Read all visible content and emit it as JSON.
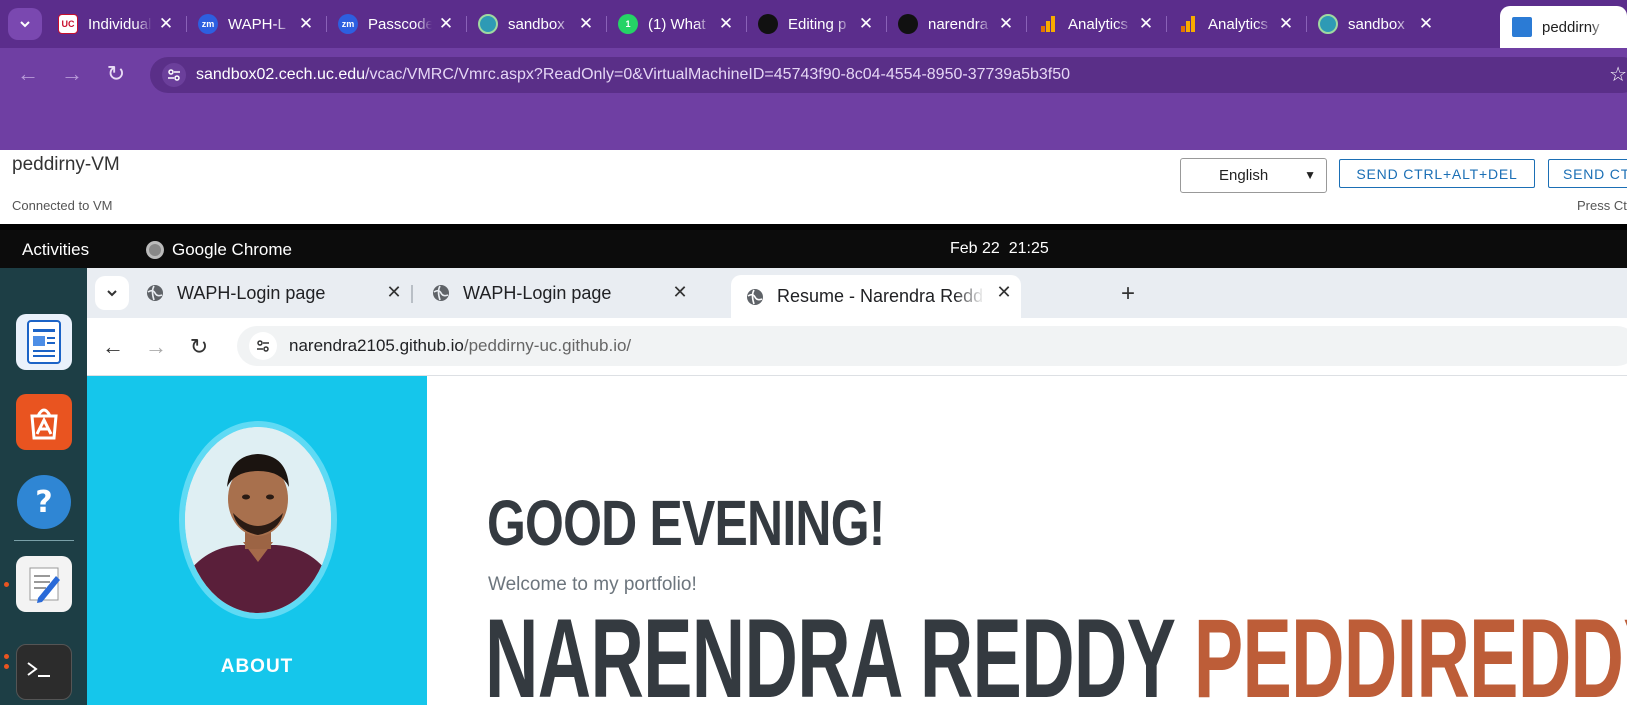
{
  "outer_browser": {
    "tabs": [
      {
        "title": "Individual",
        "favicon": "uc-logo-icon",
        "color": "#c8102e"
      },
      {
        "title": "WAPH-L",
        "favicon": "zoom-icon",
        "color": "#2d5fe0"
      },
      {
        "title": "Passcode",
        "favicon": "zoom-icon",
        "color": "#2d5fe0"
      },
      {
        "title": "sandbox",
        "favicon": "globe-icon",
        "color": "#2e9ab5"
      },
      {
        "title": "(1) What",
        "favicon": "whatsapp-icon",
        "color": "#25d366"
      },
      {
        "title": "Editing p",
        "favicon": "github-icon",
        "color": "#000000"
      },
      {
        "title": "narendra",
        "favicon": "github-icon",
        "color": "#000000"
      },
      {
        "title": "Analytics",
        "favicon": "analytics-icon",
        "color": "#f9ab00"
      },
      {
        "title": "Analytics",
        "favicon": "analytics-icon",
        "color": "#f9ab00"
      },
      {
        "title": "sandbox",
        "favicon": "globe-icon",
        "color": "#2e9ab5"
      },
      {
        "title": "peddirny",
        "favicon": "monitor-icon",
        "color": "#2b7bd5",
        "active": true
      }
    ],
    "address": {
      "host": "sandbox02.cech.uc.edu",
      "path": "/vcac/VMRC/Vmrc.aspx?ReadOnly=0&VirtualMachineID=45743f90-8c04-4554-8950-37739a5b3f50"
    }
  },
  "vmrc": {
    "vm_name": "peddirny-VM",
    "status": "Connected to VM",
    "language": "English",
    "buttons": [
      "SEND CTRL+ALT+DEL",
      "SEND CT"
    ],
    "hint": "Press Ct"
  },
  "guest": {
    "topbar": {
      "activities": "Activities",
      "app_name": "Google Chrome",
      "date": "Feb 22",
      "time": "21:25"
    },
    "inner_browser": {
      "tabs": [
        {
          "title": "WAPH-Login page"
        },
        {
          "title": "WAPH-Login page"
        },
        {
          "title": "Resume - Narendra Redd",
          "active": true
        }
      ],
      "address": {
        "host": "narendra2105.github.io",
        "path": "/peddirny-uc.github.io/"
      }
    },
    "page": {
      "greeting": "GOOD EVENING!",
      "welcome": "Welcome to my portfolio!",
      "first_name": "NARENDRA REDDY",
      "last_name": "PEDDIREDDY",
      "sidebar_link": "ABOUT",
      "colors": {
        "sidebar": "#15c6eb",
        "accent": "#bd5d38",
        "heading": "#343a40"
      }
    }
  }
}
